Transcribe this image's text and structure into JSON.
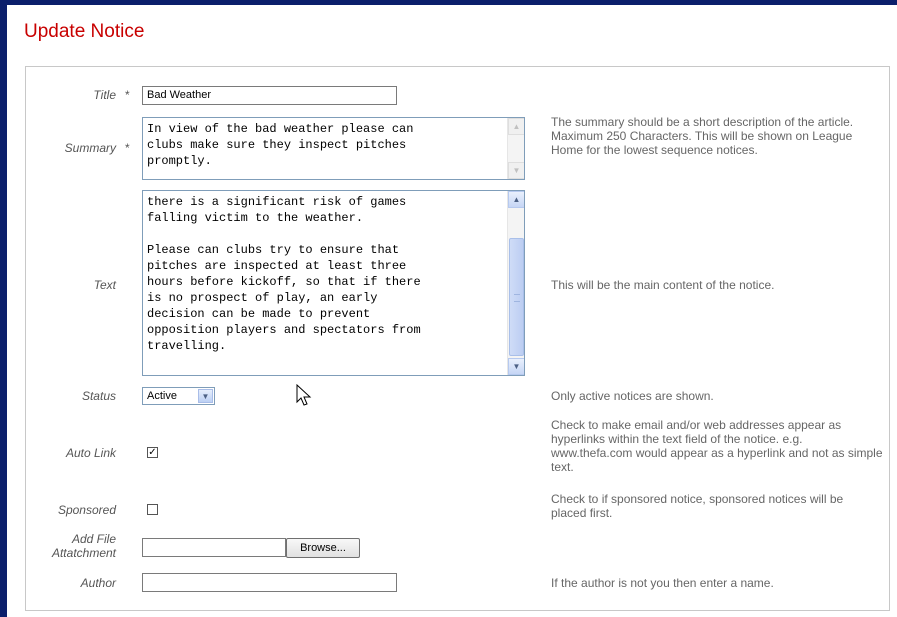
{
  "page": {
    "title": "Update Notice"
  },
  "fields": {
    "title": {
      "label": "Title",
      "required_mark": "*",
      "value": "Bad Weather"
    },
    "summary": {
      "label": "Summary",
      "required_mark": "*",
      "value": "In view of the bad weather please can\nclubs make sure they inspect pitches\npromptly.",
      "help": "The summary should be a short description of the article. Maximum 250 Characters. This will be shown on League Home for the lowest sequence notices."
    },
    "text": {
      "label": "Text",
      "value": "there is a significant risk of games\nfalling victim to the weather.\n\nPlease can clubs try to ensure that\npitches are inspected at least three\nhours before kickoff, so that if there\nis no prospect of play, an early\ndecision can be made to prevent\nopposition players and spectators from\ntravelling.",
      "help": "This will be the main content of the notice."
    },
    "status": {
      "label": "Status",
      "value": "Active",
      "help": "Only active notices are shown."
    },
    "auto_link": {
      "label": "Auto Link",
      "checked": true,
      "check_glyph": "✓",
      "help": "Check to make email and/or web addresses appear as hyperlinks within the text field of the notice. e.g. www.thefa.com would appear as a hyperlink and not as simple text."
    },
    "sponsored": {
      "label": "Sponsored",
      "checked": false,
      "help": "Check to if sponsored notice, sponsored notices will be placed first."
    },
    "attachment": {
      "label_line1": "Add File",
      "label_line2": "Attatchment",
      "value": "",
      "button_label": "Browse..."
    },
    "author": {
      "label": "Author",
      "value": "",
      "help": "If the author is not you then enter a name."
    }
  },
  "icons": {
    "scroll_up": "▲",
    "scroll_down": "▼",
    "dropdown": "▼"
  },
  "colors": {
    "frame": "#0b1f6b",
    "title": "#c80000"
  }
}
